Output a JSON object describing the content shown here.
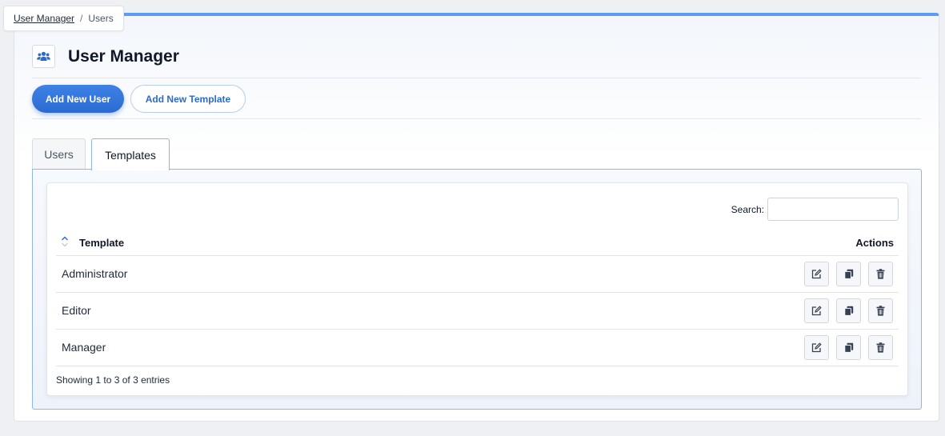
{
  "breadcrumb": {
    "parent": "User Manager",
    "separator": "/",
    "current": "Users"
  },
  "header": {
    "title": "User Manager",
    "icon": "users-icon"
  },
  "toolbar": {
    "add_user_label": "Add New User",
    "add_template_label": "Add New Template"
  },
  "tabs": [
    {
      "label": "Users",
      "active": false
    },
    {
      "label": "Templates",
      "active": true
    }
  ],
  "table": {
    "search_label": "Search:",
    "search_value": "",
    "columns": {
      "template": "Template",
      "actions": "Actions"
    },
    "rows": [
      {
        "name": "Administrator"
      },
      {
        "name": "Editor"
      },
      {
        "name": "Manager"
      }
    ],
    "row_actions": [
      "edit-icon",
      "copy-icon",
      "trash-icon"
    ],
    "info": "Showing 1 to 3 of 3 entries"
  },
  "colors": {
    "accent": "#2b6bd1",
    "top_border": "#5b9cf5",
    "tab_border": "#8fb6ea"
  }
}
